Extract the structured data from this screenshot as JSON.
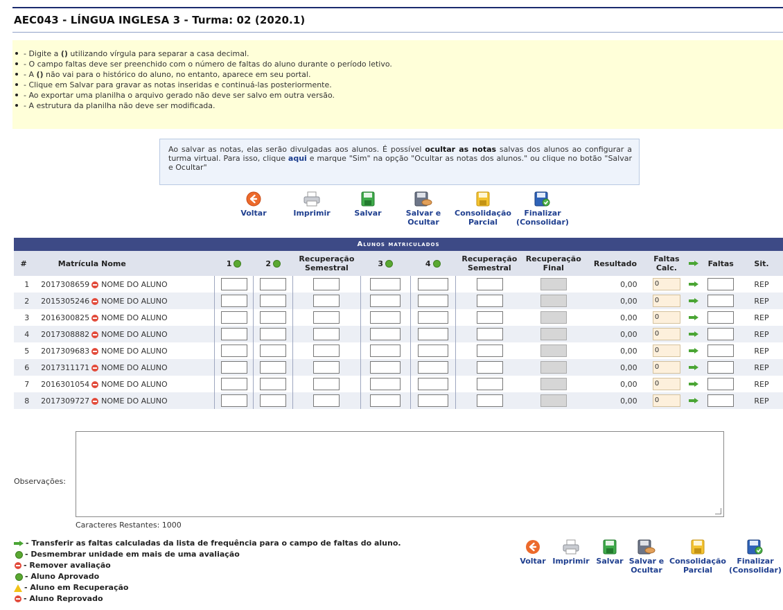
{
  "header": {
    "title": "AEC043 - LÍNGUA INGLESA 3 - Turma: 02 (2020.1)"
  },
  "tips": [
    {
      "pre": "- Digite a ",
      "bold": "()",
      "post": " utilizando vírgula para separar a casa decimal."
    },
    {
      "pre": "- O campo faltas deve ser preenchido com o número de faltas do aluno durante o período letivo.",
      "bold": "",
      "post": ""
    },
    {
      "pre": "- A ",
      "bold": "()",
      "post": " não vai para o histórico do aluno, no entanto, aparece em seu portal."
    },
    {
      "pre": "- Clique em Salvar para gravar as notas inseridas e continuá-las posteriormente.",
      "bold": "",
      "post": ""
    },
    {
      "pre": "- Ao exportar uma planilha o arquivo gerado não deve ser salvo em outra versão.",
      "bold": "",
      "post": ""
    },
    {
      "pre": "- A estrutura da planilha não deve ser modificada.",
      "bold": "",
      "post": ""
    }
  ],
  "info": {
    "p1": "Ao salvar as notas, elas serão divulgadas aos alunos. É possível ",
    "strong": "ocultar as notas",
    "p2": " salvas dos alunos ao configurar a turma virtual. Para isso, clique ",
    "link": "aqui",
    "p3": " e marque \"Sim\" na opção \"Ocultar as notas dos alunos.\" ou clique no botão \"Salvar e Ocultar\""
  },
  "toolbar": {
    "voltar": "Voltar",
    "imprimir": "Imprimir",
    "salvar": "Salvar",
    "salvar_ocultar_1": "Salvar e",
    "salvar_ocultar_2": "Ocultar",
    "consolidacao_1": "Consolidação",
    "consolidacao_2": "Parcial",
    "finalizar_1": "Finalizar",
    "finalizar_2": "(Consolidar)"
  },
  "table": {
    "section_title": "Alunos matriculados",
    "headers": {
      "num": "#",
      "matricula": "Matrícula",
      "nome": "Nome",
      "u1": "1",
      "u2": "2",
      "rec_sem_1a": "Recuperação",
      "rec_sem_1b": "Semestral",
      "u3": "3",
      "u4": "4",
      "rec_sem_2a": "Recuperação",
      "rec_sem_2b": "Semestral",
      "rec_final_a": "Recuperação",
      "rec_final_b": "Final",
      "resultado": "Resultado",
      "faltas_calc_a": "Faltas",
      "faltas_calc_b": "Calc.",
      "faltas": "Faltas",
      "sit": "Sit."
    },
    "rows": [
      {
        "n": "1",
        "matricula": "2017308659",
        "nome": "NOME DO ALUNO",
        "resultado": "0,00",
        "faltas_calc": "0",
        "sit": "REP"
      },
      {
        "n": "2",
        "matricula": "2015305246",
        "nome": "NOME DO ALUNO",
        "resultado": "0,00",
        "faltas_calc": "0",
        "sit": "REP"
      },
      {
        "n": "3",
        "matricula": "2016300825",
        "nome": "NOME DO ALUNO",
        "resultado": "0,00",
        "faltas_calc": "0",
        "sit": "REP"
      },
      {
        "n": "4",
        "matricula": "2017308882",
        "nome": "NOME DO ALUNO",
        "resultado": "0,00",
        "faltas_calc": "0",
        "sit": "REP"
      },
      {
        "n": "5",
        "matricula": "2017309683",
        "nome": "NOME DO ALUNO",
        "resultado": "0,00",
        "faltas_calc": "0",
        "sit": "REP"
      },
      {
        "n": "6",
        "matricula": "2017311171",
        "nome": "NOME DO ALUNO",
        "resultado": "0,00",
        "faltas_calc": "0",
        "sit": "REP"
      },
      {
        "n": "7",
        "matricula": "2016301054",
        "nome": "NOME DO ALUNO",
        "resultado": "0,00",
        "faltas_calc": "0",
        "sit": "REP"
      },
      {
        "n": "8",
        "matricula": "2017309727",
        "nome": "NOME DO ALUNO",
        "resultado": "0,00",
        "faltas_calc": "0",
        "sit": "REP"
      }
    ]
  },
  "observacoes": {
    "label": "Observações:",
    "value": "",
    "chars_left": "Caracteres Restantes: 1000"
  },
  "legend": {
    "transferir": "- Transferir as faltas calculadas da lista de frequência para o campo de faltas do aluno.",
    "desmembrar": "- Desmembrar unidade em mais de uma avaliação",
    "remover": "- Remover avaliação",
    "aprovado": "- Aluno Aprovado",
    "recuperacao": "- Aluno em Recuperação",
    "reprovado": "- Aluno Reprovado"
  },
  "colors": {
    "accent": "#3d4a86",
    "link": "#1f3f8f",
    "tips_bg": "#ffffd9"
  }
}
